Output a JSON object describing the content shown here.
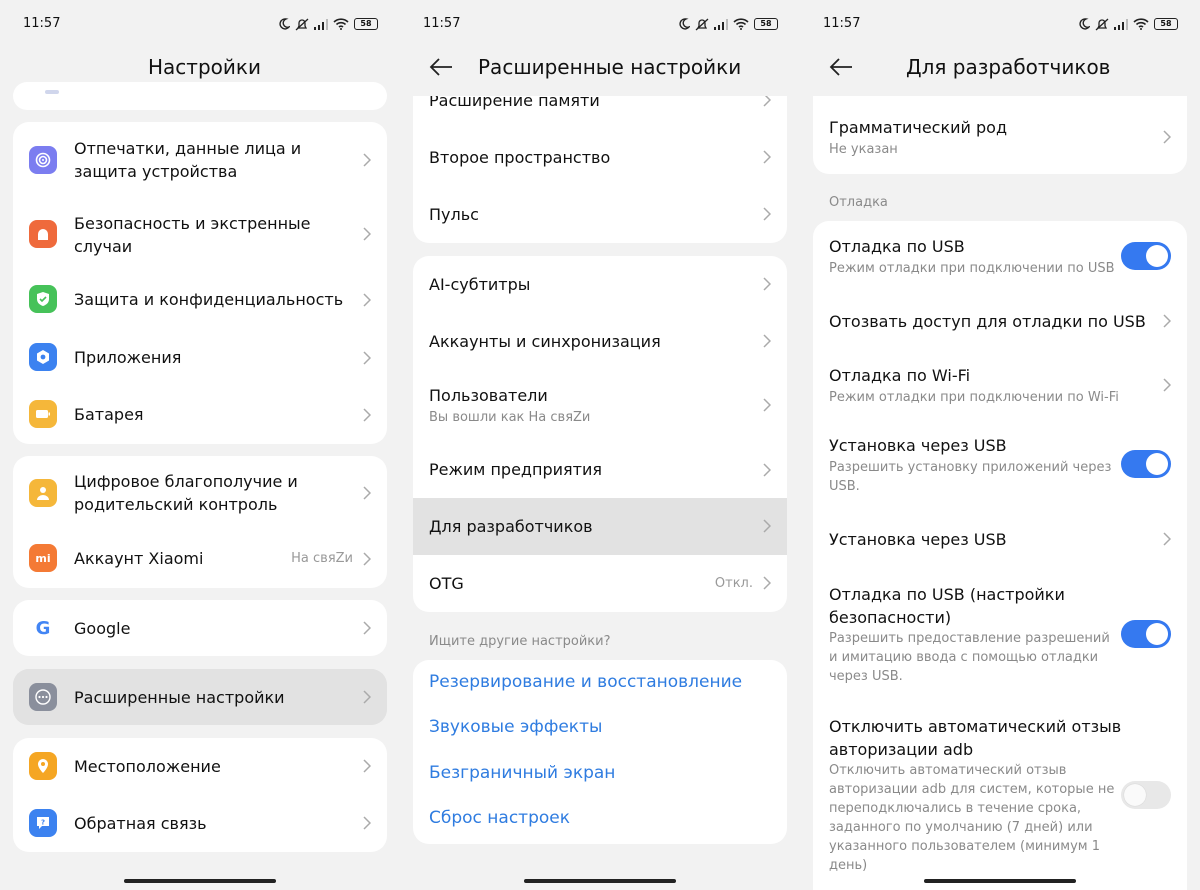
{
  "status": {
    "time": "11:57",
    "battery": "58"
  },
  "p1": {
    "title": "Настройки",
    "items": [
      {
        "label": "Отпечатки, данные лица и защита устройства",
        "icon": "fingerprint-icon",
        "color": "#7b7df0"
      },
      {
        "label": "Безопасность и экстренные случаи",
        "icon": "emergency-icon",
        "color": "#ef6a3c"
      },
      {
        "label": "Защита и конфиденциальность",
        "icon": "shield-icon",
        "color": "#46c259"
      },
      {
        "label": "Приложения",
        "icon": "apps-icon",
        "color": "#3c82f0"
      },
      {
        "label": "Батарея",
        "icon": "battery-icon",
        "color": "#f5b73a"
      },
      {
        "label": "Цифровое благополучие и родительский контроль",
        "icon": "wellbeing-icon",
        "color": "#f5b73a"
      },
      {
        "label": "Аккаунт Xiaomi",
        "value": "На свяZи",
        "icon": "xiaomi-icon",
        "color": "#f47a35"
      },
      {
        "label": "Google",
        "icon": "google-icon",
        "color": "#ffffff"
      },
      {
        "label": "Расширенные настройки",
        "icon": "more-icon",
        "color": "#8a8f9c"
      },
      {
        "label": "Местоположение",
        "icon": "location-icon",
        "color": "#f5a623"
      },
      {
        "label": "Обратная связь",
        "icon": "feedback-icon",
        "color": "#3c82f0"
      }
    ]
  },
  "p2": {
    "title": "Расширенные настройки",
    "items": [
      {
        "label": "Расширение памяти"
      },
      {
        "label": "Второе пространство"
      },
      {
        "label": "Пульс"
      },
      {
        "label": "AI-субтитры"
      },
      {
        "label": "Аккаунты и синхронизация"
      },
      {
        "label": "Пользователи",
        "sub": "Вы вошли как На свяZи"
      },
      {
        "label": "Режим предприятия"
      },
      {
        "label": "Для разработчиков"
      },
      {
        "label": "OTG",
        "value": "Откл."
      }
    ],
    "search_hint": "Ищите другие настройки?",
    "links": [
      "Резервирование и восстановление",
      "Звуковые эффекты",
      "Безграничный экран",
      "Сброс настроек"
    ]
  },
  "p3": {
    "title": "Для разработчиков",
    "gender": {
      "label": "Грамматический род",
      "sub": "Не указан"
    },
    "section": "Отладка",
    "items": [
      {
        "label": "Отладка по USB",
        "sub": "Режим отладки при подключении по USB",
        "toggle": "on"
      },
      {
        "label": "Отозвать доступ для отладки по USB"
      },
      {
        "label": "Отладка по Wi-Fi",
        "sub": "Режим отладки при подключении по Wi-Fi"
      },
      {
        "label": "Установка через USB",
        "sub": "Разрешить установку приложений через USB.",
        "toggle": "on"
      },
      {
        "label": "Установка через USB"
      },
      {
        "label": "Отладка по USB (настройки безопасности)",
        "sub": "Разрешить предоставление разрешений и имитацию ввода с помощью отладки через USB.",
        "toggle": "on"
      },
      {
        "label": "Отключить автоматический отзыв авторизации adb",
        "sub": "Отключить автоматический отзыв авторизации adb для систем, которые не переподключались в течение срока, заданного по умолчанию (7 дней) или указанного пользователем (минимум 1 день)",
        "toggle": "off"
      }
    ]
  },
  "colors": {
    "accent": "#3579f0",
    "link": "#2f7ce0",
    "highlight": "#e2e2e2"
  }
}
